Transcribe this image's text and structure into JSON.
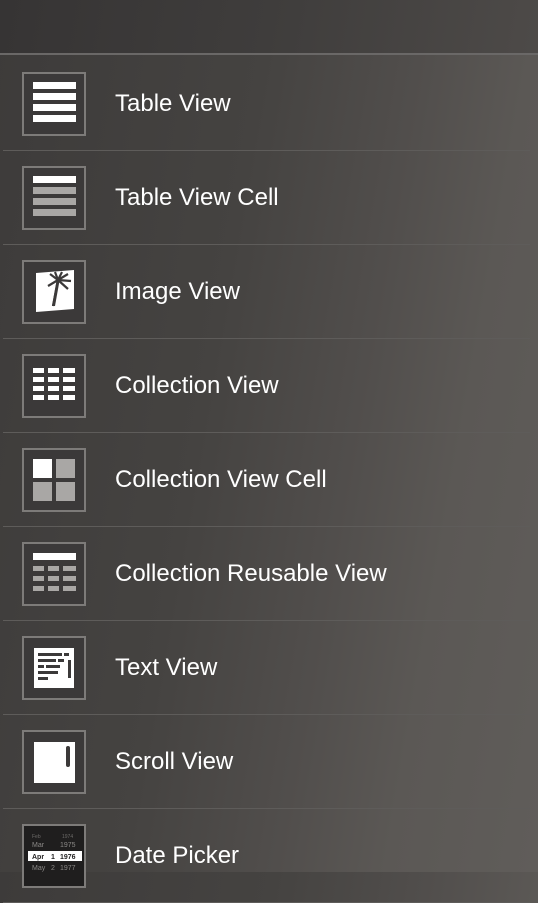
{
  "library": {
    "items": [
      {
        "label": "Table View",
        "icon": "table-view-icon"
      },
      {
        "label": "Table View Cell",
        "icon": "table-view-cell-icon"
      },
      {
        "label": "Image View",
        "icon": "image-view-icon"
      },
      {
        "label": "Collection View",
        "icon": "collection-view-icon"
      },
      {
        "label": "Collection View Cell",
        "icon": "collection-view-cell-icon"
      },
      {
        "label": "Collection Reusable View",
        "icon": "collection-reusable-view-icon"
      },
      {
        "label": "Text View",
        "icon": "text-view-icon"
      },
      {
        "label": "Scroll View",
        "icon": "scroll-view-icon"
      },
      {
        "label": "Date Picker",
        "icon": "date-picker-icon"
      }
    ],
    "date_picker_preview": {
      "rows": [
        [
          "Mar",
          "1975"
        ],
        [
          "Apr",
          "1",
          "1976"
        ],
        [
          "May",
          "2",
          "1977"
        ]
      ]
    }
  }
}
